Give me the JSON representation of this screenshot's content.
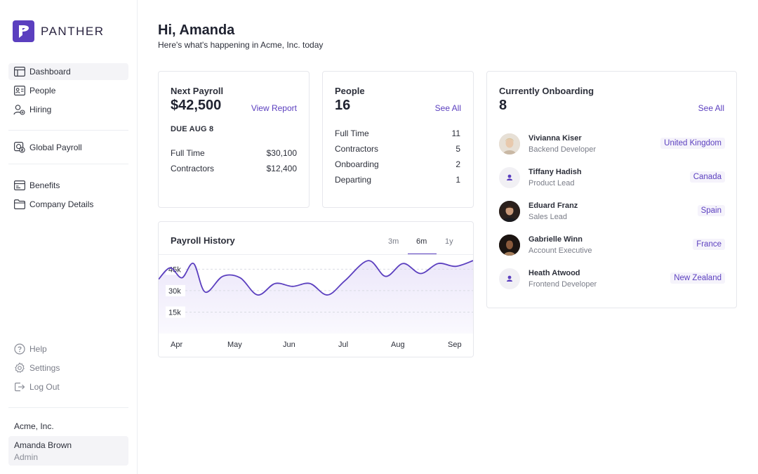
{
  "brand": {
    "name": "PANTHER",
    "color": "#5b3fbf"
  },
  "sidebar": {
    "items": [
      {
        "label": "Dashboard",
        "icon": "table-icon"
      },
      {
        "label": "People",
        "icon": "id-card-icon"
      },
      {
        "label": "Hiring",
        "icon": "user-plus-icon"
      },
      {
        "label": "Global Payroll",
        "icon": "globe-icon"
      },
      {
        "label": "Benefits",
        "icon": "card-icon"
      },
      {
        "label": "Company Details",
        "icon": "folder-icon"
      }
    ],
    "footer_items": [
      {
        "label": "Help",
        "icon": "help-icon"
      },
      {
        "label": "Settings",
        "icon": "gear-icon"
      },
      {
        "label": "Log Out",
        "icon": "logout-icon"
      }
    ],
    "company": "Acme, Inc.",
    "user": {
      "name": "Amanda Brown",
      "role": "Admin"
    }
  },
  "header": {
    "greeting": "Hi, Amanda",
    "subtitle": "Here's what's happening in Acme, Inc. today"
  },
  "payroll": {
    "title": "Next Payroll",
    "amount": "$42,500",
    "link": "View Report",
    "due": "DUE AUG 8",
    "rows": [
      {
        "label": "Full Time",
        "value": "$30,100"
      },
      {
        "label": "Contractors",
        "value": "$12,400"
      }
    ]
  },
  "people": {
    "title": "People",
    "count": "16",
    "link": "See All",
    "rows": [
      {
        "label": "Full Time",
        "value": "11"
      },
      {
        "label": "Contractors",
        "value": "5"
      },
      {
        "label": "Onboarding",
        "value": "2"
      },
      {
        "label": "Departing",
        "value": "1"
      }
    ]
  },
  "onboarding": {
    "title": "Currently Onboarding",
    "count": "8",
    "link": "See All",
    "people": [
      {
        "name": "Vivianna Kiser",
        "role": "Backend Developer",
        "country": "United Kingdom",
        "avatar": "photo"
      },
      {
        "name": "Tiffany Hadish",
        "role": "Product Lead",
        "country": "Canada",
        "avatar": "placeholder"
      },
      {
        "name": "Eduard Franz",
        "role": "Sales Lead",
        "country": "Spain",
        "avatar": "photo"
      },
      {
        "name": "Gabrielle Winn",
        "role": "Account Executive",
        "country": "France",
        "avatar": "photo"
      },
      {
        "name": "Heath Atwood",
        "role": "Frontend Developer",
        "country": "New Zealand",
        "avatar": "placeholder"
      }
    ]
  },
  "history": {
    "title": "Payroll History",
    "tabs": [
      "3m",
      "6m",
      "1y"
    ],
    "active_tab": "6m"
  },
  "chart_data": {
    "type": "area",
    "title": "",
    "xlabel": "",
    "ylabel": "",
    "ylim": [
      0,
      55
    ],
    "y_ticks": [
      "45k",
      "30k",
      "15k"
    ],
    "x_ticks": [
      "Apr",
      "May",
      "Jun",
      "Jul",
      "Aug",
      "Sep"
    ],
    "x": [
      0,
      0.2,
      0.4,
      0.6,
      0.8,
      1.1,
      1.4,
      1.7,
      2.0,
      2.3,
      2.6,
      2.9,
      3.2,
      3.6,
      3.9,
      4.2,
      4.5,
      4.8,
      5.1,
      5.4
    ],
    "values": [
      38,
      46,
      39,
      49,
      29,
      40,
      39,
      27,
      35,
      33,
      35,
      27,
      37,
      51,
      40,
      49,
      42,
      49,
      47,
      51
    ],
    "series_color": "#5b3fbf",
    "grid": true
  }
}
